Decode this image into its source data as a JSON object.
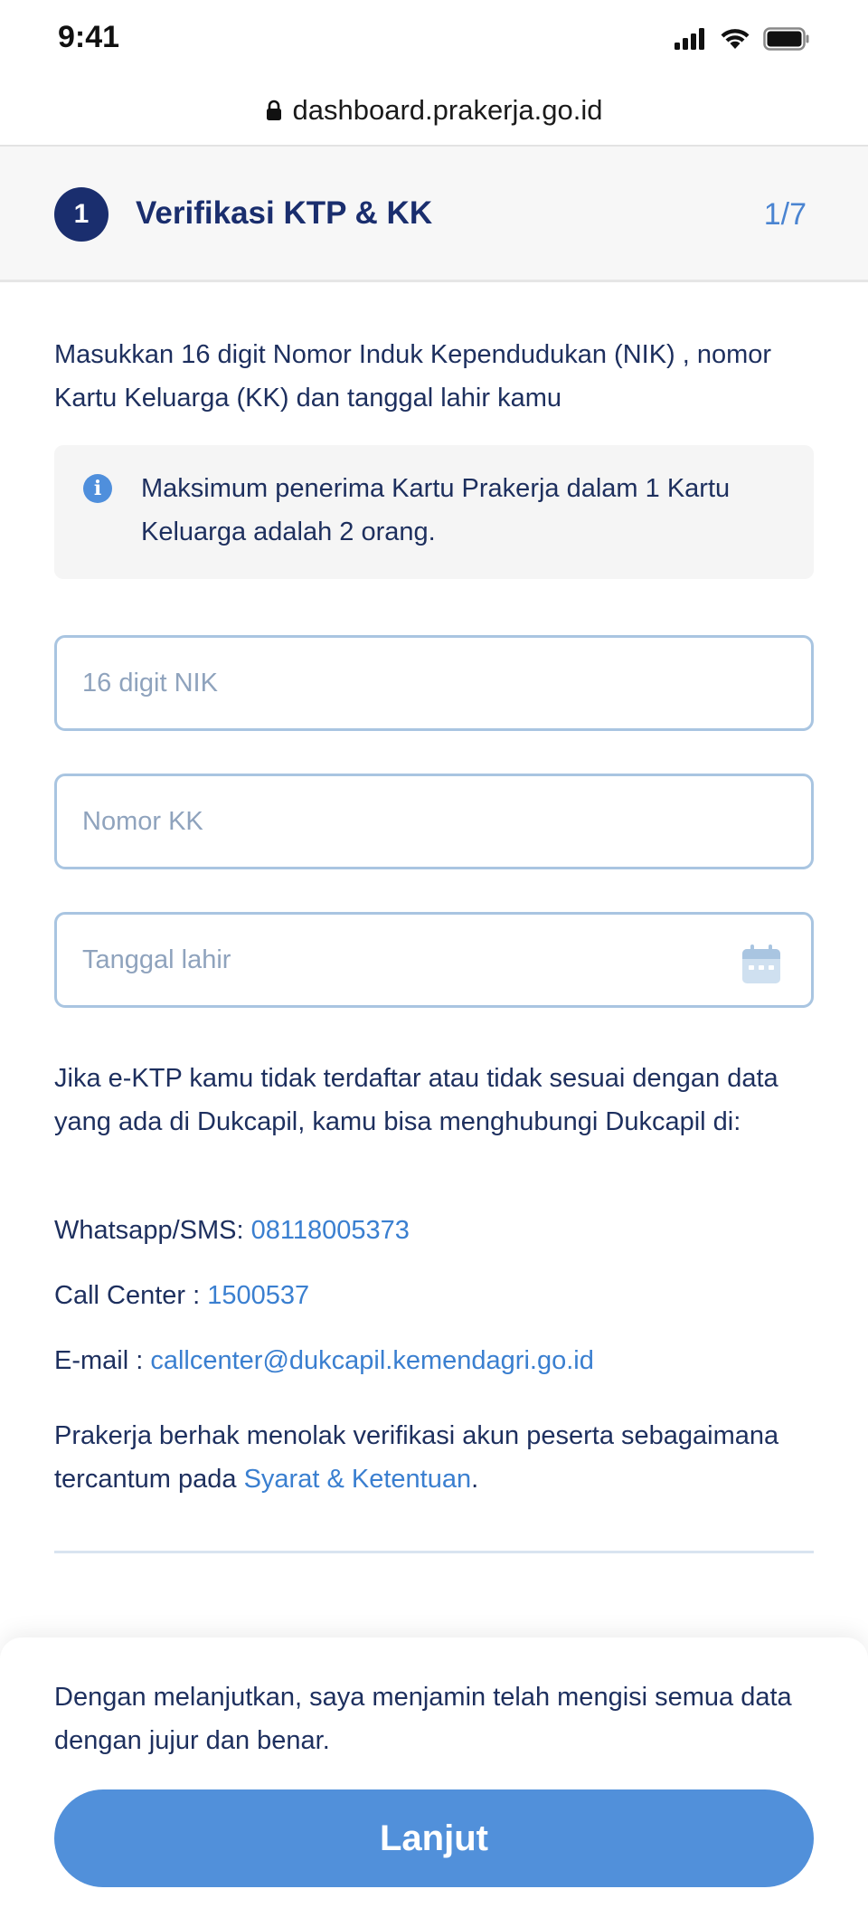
{
  "status_bar": {
    "time": "9:41",
    "icons": [
      "signal-icon",
      "wifi-icon",
      "battery-icon"
    ]
  },
  "browser": {
    "url": "dashboard.prakerja.go.id",
    "lock_icon": "lock-icon"
  },
  "step": {
    "number": "1",
    "title": "Verifikasi KTP & KK",
    "counter": "1/7"
  },
  "intro": "Masukkan 16 digit Nomor Induk Kependudukan (NIK) , nomor Kartu Keluarga (KK) dan tanggal lahir kamu",
  "info_box": {
    "icon": "info-icon",
    "text": "Maksimum penerima Kartu Prakerja dalam 1 Kartu Keluarga adalah 2 orang."
  },
  "form": {
    "nik": {
      "placeholder": "16 digit NIK",
      "value": ""
    },
    "kk": {
      "placeholder": "Nomor KK",
      "value": ""
    },
    "birthdate": {
      "placeholder": "Tanggal lahir",
      "value": "",
      "icon": "calendar-icon"
    }
  },
  "dukcapil": {
    "note": "Jika e-KTP kamu tidak terdaftar atau tidak sesuai dengan data yang ada di Dukcapil, kamu bisa menghubungi Dukcapil di:",
    "whatsapp_label": "Whatsapp/SMS: ",
    "whatsapp_value": "08118005373",
    "callcenter_label": "Call Center : ",
    "callcenter_value": "1500537",
    "email_label": "E-mail : ",
    "email_value": "callcenter@dukcapil.kemendagri.go.id"
  },
  "terms": {
    "text": "Prakerja berhak menolak verifikasi akun peserta sebagaimana tercantum pada ",
    "link": "Syarat & Ketentuan",
    "suffix": "."
  },
  "footer": {
    "agreement": "Dengan melanjutkan, saya menjamin telah mengisi semua data dengan jujur dan benar.",
    "button_label": "Lanjut"
  },
  "colors": {
    "primary_dark": "#1a2e6e",
    "link": "#3a7fd0",
    "button": "#5190da",
    "field_border": "#a9c5e1"
  }
}
